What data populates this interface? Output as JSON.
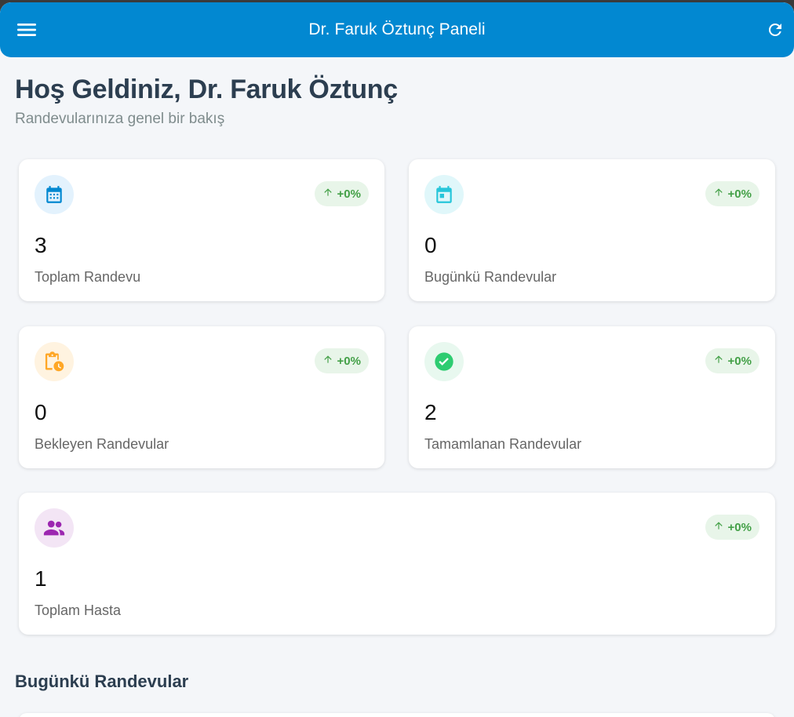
{
  "appbar": {
    "title": "Dr. Faruk Öztunç Paneli",
    "menu_icon": "menu-icon",
    "refresh_icon": "refresh-icon"
  },
  "welcome": {
    "title": "Hoş Geldiniz, Dr. Faruk Öztunç",
    "subtitle": "Randevularınıza genel bir bakış"
  },
  "stats": [
    {
      "value": "3",
      "label": "Toplam Randevu",
      "badge": "+0%",
      "icon": "calendar-month-icon",
      "icon_color": "#0288d1",
      "icon_bg": "#e3f2fd"
    },
    {
      "value": "0",
      "label": "Bugünkü Randevular",
      "badge": "+0%",
      "icon": "calendar-today-icon",
      "icon_color": "#26c6da",
      "icon_bg": "#e0f7fa"
    },
    {
      "value": "0",
      "label": "Bekleyen Randevular",
      "badge": "+0%",
      "icon": "pending-clipboard-icon",
      "icon_color": "#ffa726",
      "icon_bg": "#fff3e0"
    },
    {
      "value": "2",
      "label": "Tamamlanan Randevular",
      "badge": "+0%",
      "icon": "check-circle-icon",
      "icon_color": "#2ecc71",
      "icon_bg": "#e8f8ef"
    },
    {
      "value": "1",
      "label": "Toplam Hasta",
      "badge": "+0%",
      "icon": "people-icon",
      "icon_color": "#9c27b0",
      "icon_bg": "#f3e5f5"
    }
  ],
  "badge_color": "#43a047",
  "today_section": {
    "title": "Bugünkü Randevular"
  }
}
